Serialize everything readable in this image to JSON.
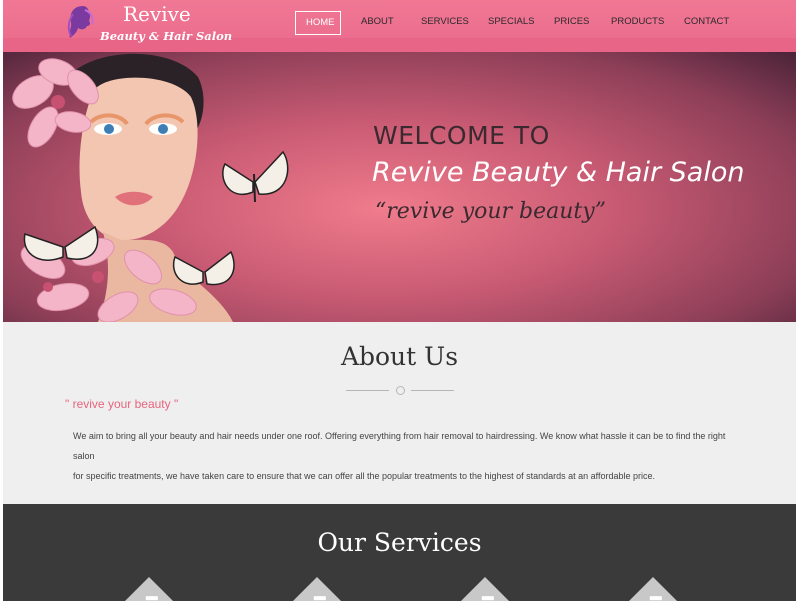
{
  "brand": {
    "title": "Revive",
    "subtitle": "Beauty & Hair Salon"
  },
  "nav": {
    "items": [
      "HOME",
      "ABOUT",
      "SERVICES",
      "SPECIALS",
      "PRICES",
      "PRODUCTS",
      "CONTACT"
    ],
    "active": "HOME"
  },
  "hero": {
    "welcome": "WELCOME TO",
    "name": "Revive Beauty & Hair Salon",
    "tagline": "“revive your beauty”"
  },
  "about": {
    "title": "About Us",
    "quote": "\" revive your beauty \"",
    "text_line1": "We aim to bring all your beauty and hair needs under one roof. Offering everything from hair removal to hairdressing. We know what hassle it can be to find the right salon",
    "text_line2": "for specific treatments, we have taken care to ensure that we can offer all the popular treatments to the highest of standards at an affordable price."
  },
  "services": {
    "title": "Our Services"
  },
  "colors": {
    "header_pink": "#ec6e8e",
    "accent_quote": "#e6657d",
    "services_bg": "#3a3a3a"
  }
}
